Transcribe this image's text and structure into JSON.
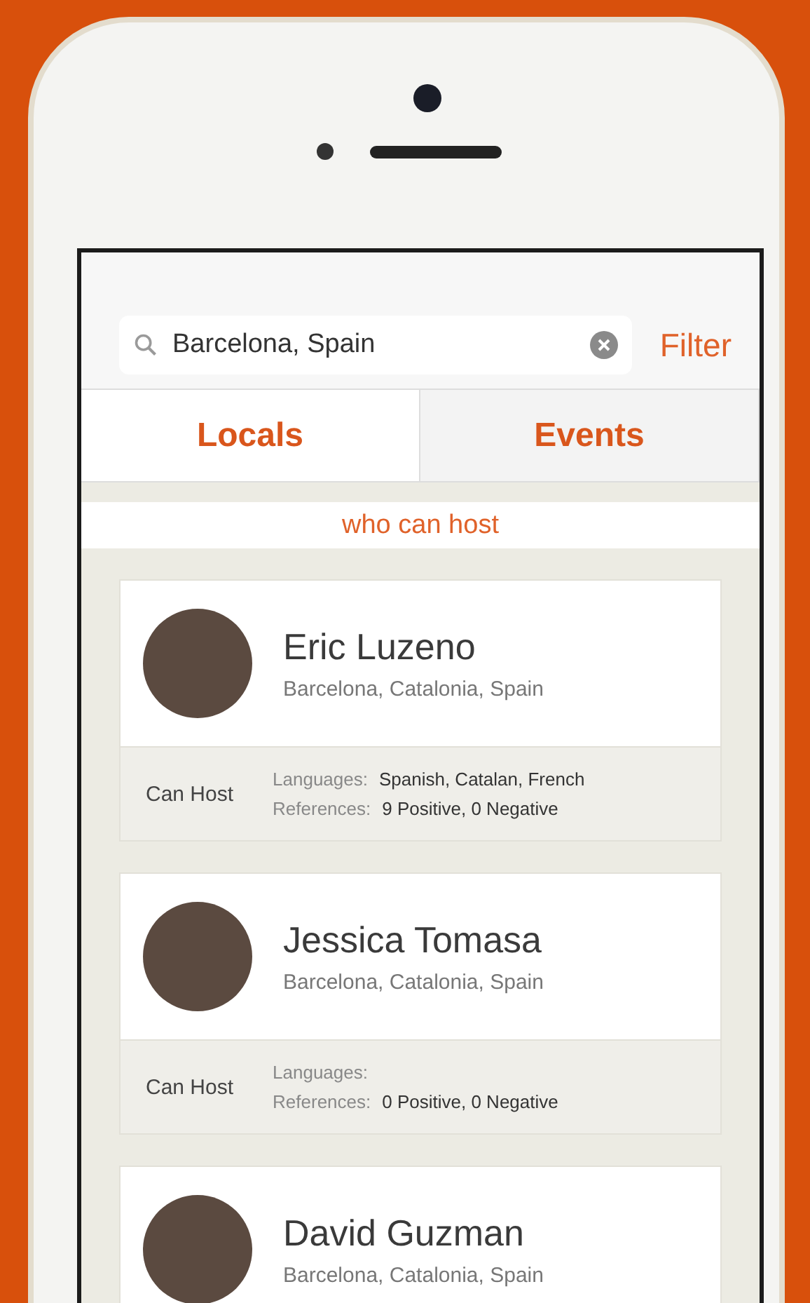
{
  "search": {
    "value": "Barcelona, Spain"
  },
  "filter_button": "Filter",
  "tabs": [
    {
      "label": "Locals",
      "selected": true
    },
    {
      "label": "Events",
      "selected": false
    }
  ],
  "list_header": "who can host",
  "people": [
    {
      "name": "Eric Luzeno",
      "location": "Barcelona, Catalonia, Spain",
      "details": {
        "status": "Can Host",
        "languages_label": "Languages:",
        "languages": "Spanish, Catalan, French",
        "references_label": "References:",
        "references": "9 Positive, 0 Negative"
      }
    },
    {
      "name": "Jessica Tomasa",
      "location": "Barcelona, Catalonia, Spain",
      "details": {
        "status": "Can Host",
        "languages_label": "Languages:",
        "references_label": "References:",
        "references": "0 Positive, 0 Negative"
      }
    },
    {
      "name": "David Guzman",
      "location": "Barcelona, Catalonia, Spain"
    }
  ]
}
